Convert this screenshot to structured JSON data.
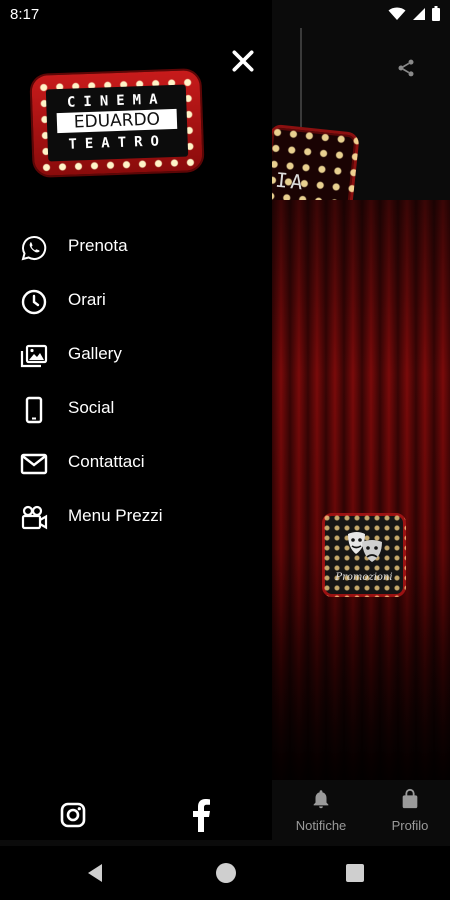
{
  "status_bar": {
    "time": "8:17"
  },
  "logo": {
    "line1": "CINEMA",
    "line2": "EDUARDO",
    "line3": "TEATRO"
  },
  "background_sign": {
    "letters": "IA\nDO\nRO"
  },
  "promo_badge": {
    "label": "Promozioni"
  },
  "drawer": {
    "menu": [
      {
        "label": "Prenota",
        "icon": "whatsapp-icon"
      },
      {
        "label": "Orari",
        "icon": "clock-icon"
      },
      {
        "label": "Gallery",
        "icon": "gallery-icon"
      },
      {
        "label": "Social",
        "icon": "smartphone-icon"
      },
      {
        "label": "Contattaci",
        "icon": "mail-icon"
      },
      {
        "label": "Menu Prezzi",
        "icon": "video-camera-icon"
      }
    ]
  },
  "tabs": [
    {
      "label": "Notifiche",
      "icon": "bell-icon"
    },
    {
      "label": "Profilo",
      "icon": "lock-icon"
    }
  ],
  "colors": {
    "accent_red": "#c71b1b",
    "bulb": "#fff4c8",
    "drawer_bg": "#000000",
    "inactive_tab": "#9a9a9a"
  }
}
